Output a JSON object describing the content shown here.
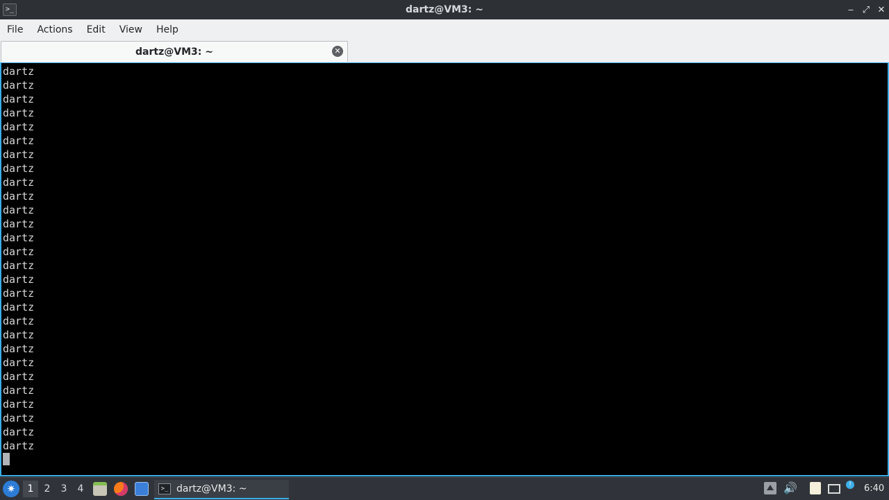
{
  "window": {
    "title": "dartz@VM3: ~",
    "app_icon_glyph": ">_",
    "controls": [
      "minimize",
      "maximize",
      "close"
    ],
    "minimize_glyph": "‒",
    "maximize_glyph": "⤢",
    "close_glyph": "✕"
  },
  "menubar": {
    "items": [
      "File",
      "Actions",
      "Edit",
      "View",
      "Help"
    ]
  },
  "tabs": [
    {
      "label": "dartz@VM3: ~",
      "active": true,
      "close_glyph": "✕"
    }
  ],
  "terminal": {
    "background": "#000000",
    "foreground": "#d8d8d8",
    "lines": [
      "dartz",
      "dartz",
      "dartz",
      "dartz",
      "dartz",
      "dartz",
      "dartz",
      "dartz",
      "dartz",
      "dartz",
      "dartz",
      "dartz",
      "dartz",
      "dartz",
      "dartz",
      "dartz",
      "dartz",
      "dartz",
      "dartz",
      "dartz",
      "dartz",
      "dartz",
      "dartz",
      "dartz",
      "dartz",
      "dartz",
      "dartz",
      "dartz"
    ]
  },
  "taskbar": {
    "start_glyph": "✷",
    "desktops": [
      "1",
      "2",
      "3",
      "4"
    ],
    "active_desktop": "1",
    "launchers": [
      "file-manager-icon",
      "firefox-icon",
      "show-desktop-icon"
    ],
    "tasks": [
      {
        "label": "dartz@VM3: ~",
        "icon_glyph": ">_",
        "active": true
      }
    ],
    "tray": {
      "volume_glyph": "🔊",
      "notify_glyph": "!"
    },
    "clock": "6:40"
  },
  "colors": {
    "accent": "#3daee9",
    "titlebar": "#2d3035",
    "menubar": "#eff0f1",
    "taskbar": "#30343a"
  }
}
